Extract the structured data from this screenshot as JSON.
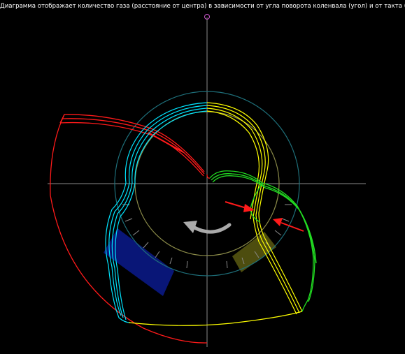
{
  "title": "Диаграмма отображает количество газа (расстояние от центра) в зависимости от угла поворота коленвала (угол) и от такта (цвет)",
  "colors": {
    "background": "#000000",
    "axis": "#8a8a8a",
    "outer_ring": "#1e6f7a",
    "inner_ring": "#8a8a48",
    "tdc_marker": "#cc55cc",
    "intake": "#00e5ff",
    "compression": "#ffff00",
    "power": "#ff1a1a",
    "exhaust": "#22dd22",
    "sector_blue": "#0b1a8c",
    "sector_olive": "#5a5a12",
    "rotation_arrow": "#aaaaaa",
    "pointer_arrow": "#ff1a1a"
  },
  "icons": [
    "tdc-marker-icon",
    "rotation-arrow-icon",
    "pointer-arrow-icon"
  ]
}
